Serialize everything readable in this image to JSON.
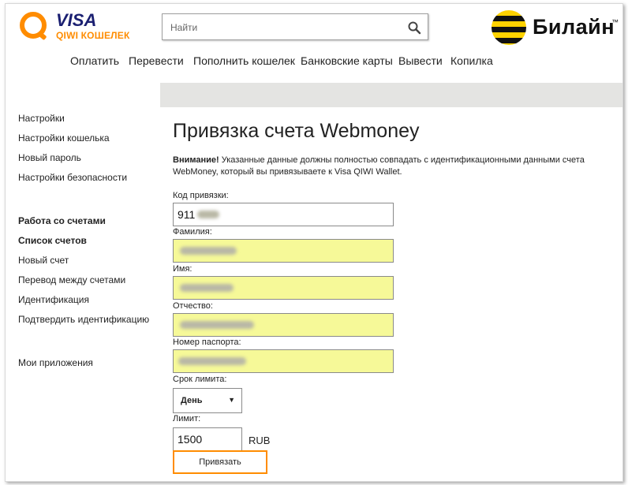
{
  "header": {
    "logo": {
      "visa": "VISA",
      "qiwi": "QIWI КОШЕЛЕК"
    },
    "search": {
      "placeholder": "Найти"
    },
    "beeline": {
      "text": "Билайн",
      "tm": "™"
    }
  },
  "nav": [
    "Оплатить",
    "Перевести",
    "Пополнить кошелек",
    "Банковские карты",
    "Вывести",
    "Копилка"
  ],
  "sidebar": {
    "items": [
      {
        "label": "Настройки",
        "bold": false
      },
      {
        "label": "Настройки кошелька",
        "bold": false
      },
      {
        "label": "Новый пароль",
        "bold": false
      },
      {
        "label": "Настройки безопасности",
        "bold": false
      },
      {
        "label": "Работа со счетами",
        "bold": true
      },
      {
        "label": "Список счетов",
        "bold": true
      },
      {
        "label": "Новый счет",
        "bold": false
      },
      {
        "label": "Перевод между счетами",
        "bold": false
      },
      {
        "label": "Идентификация",
        "bold": false
      },
      {
        "label": "Подтвердить идентификацию",
        "bold": false
      },
      {
        "label": "Мои приложения",
        "bold": false
      }
    ]
  },
  "form": {
    "title": "Привязка счета Webmoney",
    "notice_bold": "Внимание!",
    "notice_text": " Указанные данные должны полностью совпадать с идентификационными данными счета WebMoney, который вы привязываете к Visa QIWI Wallet.",
    "code_label": "Код привязки:",
    "code_value": "911",
    "surname_label": "Фамилия:",
    "name_label": "Имя:",
    "patronymic_label": "Отчество:",
    "passport_label": "Номер паспорта:",
    "term_label": "Срок лимита:",
    "term_value": "День",
    "limit_label": "Лимит:",
    "limit_value": "1500",
    "currency": "RUB",
    "submit_label": "Привязать"
  },
  "colors": {
    "accent": "#ff8c00",
    "field_highlight": "#f6f998",
    "band": "#e4e4e2"
  }
}
